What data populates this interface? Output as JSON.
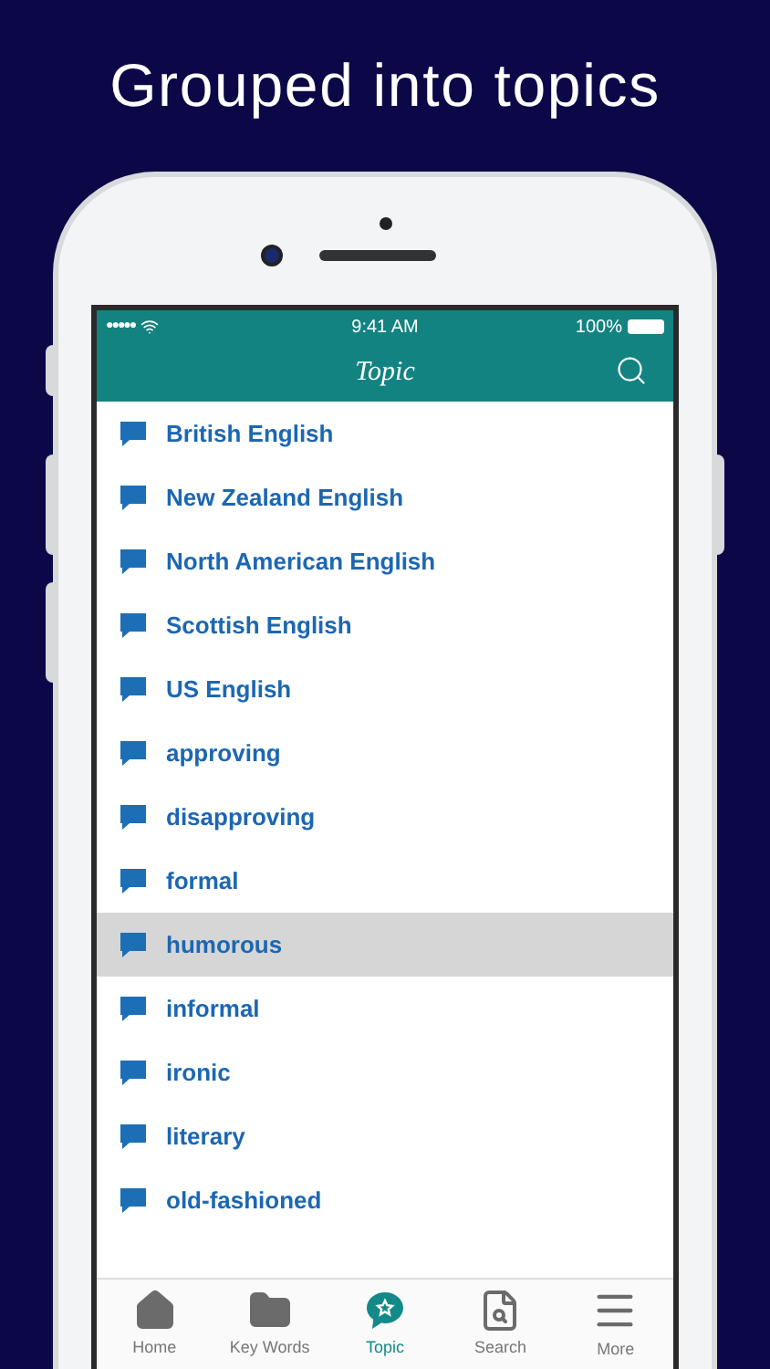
{
  "headline": "Grouped into topics",
  "status_bar": {
    "signal": "●●●●●",
    "time": "9:41 AM",
    "battery": "100%"
  },
  "nav_bar": {
    "title": "Topic"
  },
  "topics": [
    {
      "label": "British English",
      "selected": false
    },
    {
      "label": "New Zealand English",
      "selected": false
    },
    {
      "label": "North American English",
      "selected": false
    },
    {
      "label": "Scottish English",
      "selected": false
    },
    {
      "label": "US English",
      "selected": false
    },
    {
      "label": "approving",
      "selected": false
    },
    {
      "label": "disapproving",
      "selected": false
    },
    {
      "label": "formal",
      "selected": false
    },
    {
      "label": "humorous",
      "selected": true
    },
    {
      "label": "informal",
      "selected": false
    },
    {
      "label": "ironic",
      "selected": false
    },
    {
      "label": "literary",
      "selected": false
    },
    {
      "label": "old-fashioned",
      "selected": false
    }
  ],
  "tab_bar": [
    {
      "kind": "home",
      "label": "Home",
      "selected": false
    },
    {
      "kind": "folder",
      "label": "Key Words",
      "selected": false
    },
    {
      "kind": "topic",
      "label": "Topic",
      "selected": true
    },
    {
      "kind": "search",
      "label": "Search",
      "selected": false
    },
    {
      "kind": "more",
      "label": "More",
      "selected": false
    }
  ]
}
